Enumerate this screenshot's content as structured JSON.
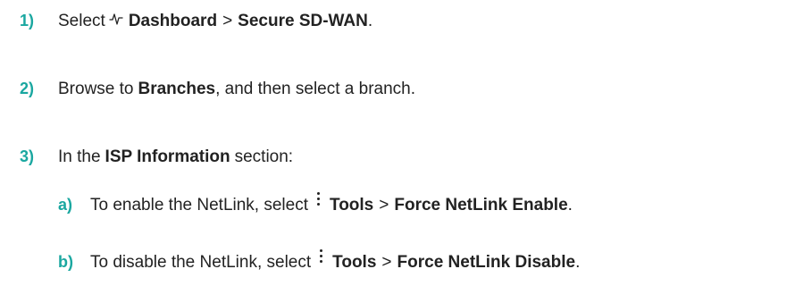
{
  "steps": [
    {
      "num": "1)",
      "parts": {
        "t1": "Select",
        "icon": "pulse-icon",
        "b1": "Dashboard",
        "sep": ">",
        "b2": "Secure SD-WAN",
        "end": "."
      }
    },
    {
      "num": "2)",
      "parts": {
        "t1": "Browse to",
        "b1": "Branches",
        "t2": ", and then select a branch."
      }
    },
    {
      "num": "3)",
      "parts": {
        "t1": "In the",
        "b1": "ISP Information",
        "t2": "section:"
      },
      "substeps": [
        {
          "num": "a)",
          "t1": "To enable the NetLink, select",
          "icon": "vertical-dots-icon",
          "b1": "Tools",
          "sep": ">",
          "b2": "Force NetLink Enable",
          "end": "."
        },
        {
          "num": "b)",
          "t1": "To disable the NetLink, select",
          "icon": "vertical-dots-icon",
          "b1": "Tools",
          "sep": ">",
          "b2": "Force NetLink Disable",
          "end": "."
        }
      ]
    }
  ],
  "colors": {
    "step_number": "#1aa7a0",
    "text": "#222222"
  }
}
